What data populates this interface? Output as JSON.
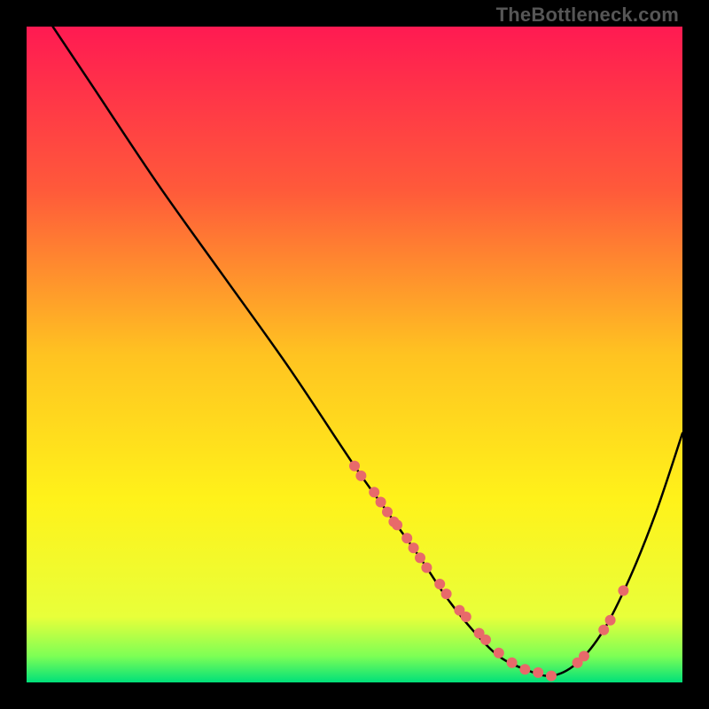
{
  "watermark": "TheBottleneck.com",
  "chart_data": {
    "type": "line",
    "title": "",
    "xlabel": "",
    "ylabel": "",
    "xlim": [
      0,
      100
    ],
    "ylim": [
      0,
      100
    ],
    "grid": false,
    "legend": false,
    "gradient_stops": [
      {
        "offset": 0.0,
        "color": "#ff1a52"
      },
      {
        "offset": 0.25,
        "color": "#ff5a3a"
      },
      {
        "offset": 0.5,
        "color": "#ffc321"
      },
      {
        "offset": 0.72,
        "color": "#fff21a"
      },
      {
        "offset": 0.9,
        "color": "#e8ff3a"
      },
      {
        "offset": 0.96,
        "color": "#7dff55"
      },
      {
        "offset": 1.0,
        "color": "#00e07a"
      }
    ],
    "series": [
      {
        "name": "bottleneck-curve",
        "x": [
          4,
          10,
          20,
          30,
          40,
          50,
          55,
          60,
          64,
          68,
          72,
          76,
          80,
          84,
          88,
          92,
          96,
          100
        ],
        "y": [
          100,
          91,
          76,
          62,
          48,
          33,
          26,
          19,
          13,
          8,
          4,
          2,
          1,
          3,
          8,
          16,
          26,
          38
        ]
      }
    ],
    "scatter_points": {
      "name": "highlighted-points",
      "color": "#e86a6a",
      "x": [
        50,
        51,
        53,
        54,
        55,
        56,
        56.5,
        58,
        59,
        60,
        61,
        63,
        64,
        66,
        67,
        69,
        70,
        72,
        74,
        76,
        78,
        80,
        84,
        85,
        88,
        89,
        91
      ],
      "y": [
        33,
        31.5,
        29,
        27.5,
        26,
        24.5,
        24,
        22,
        20.5,
        19,
        17.5,
        15,
        13.5,
        11,
        10,
        7.5,
        6.5,
        4.5,
        3,
        2,
        1.5,
        1,
        3,
        4,
        8,
        9.5,
        14
      ]
    }
  }
}
